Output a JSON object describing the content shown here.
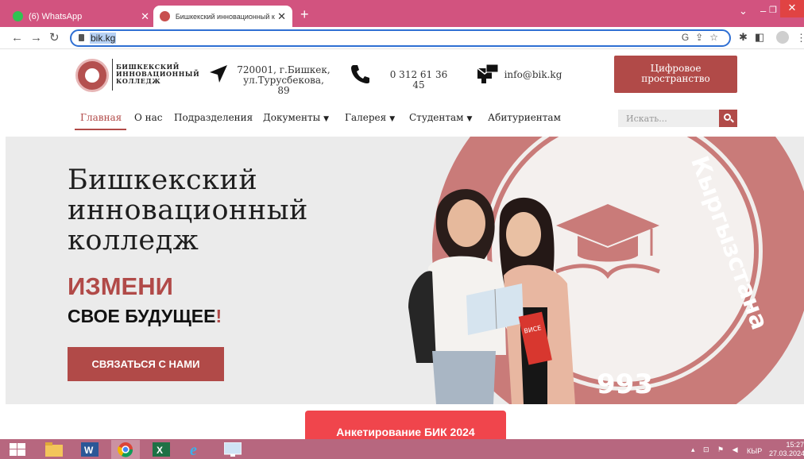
{
  "browser": {
    "tabs": [
      {
        "title": "(6) WhatsApp",
        "icon": "whatsapp-icon"
      },
      {
        "title": "Бишкекский инновационный к",
        "icon": "college-favicon"
      }
    ],
    "url": "bik.kg"
  },
  "logo": {
    "line1": "БИШКЕКСКИЙ",
    "line2": "ИННОВАЦИОННЫЙ",
    "line3": "КОЛЛЕДЖ"
  },
  "contact": {
    "address_line1": "720001, г.Бишкек,",
    "address_line2": "ул.Турусбекова, 89",
    "phone": "0 312 61 36 45",
    "email": "info@bik.kg"
  },
  "digital_button": {
    "line1": "Цифровое",
    "line2": "пространство"
  },
  "nav": {
    "items": [
      "Главная",
      "О нас",
      "Подразделения",
      "Документы",
      "Галерея",
      "Студентам",
      "Абитуриентам"
    ],
    "active": "Главная"
  },
  "search": {
    "placeholder": "Искать..."
  },
  "hero": {
    "title_line1": "Бишкекский",
    "title_line2": "инновационный",
    "title_line3": "колледж",
    "change": "ИЗМЕНИ",
    "future": "СВОЕ БУДУЩЕЕ",
    "excl": "!",
    "contact_button": "СВЯЗАТЬСЯ С НАМИ",
    "seal_text": "Кыргызстана",
    "seal_year": "993",
    "book_label": "ВИСЕ"
  },
  "survey_button": "Анкетирование БИК 2024",
  "taskbar": {
    "lang": "КЫР",
    "time": "15:27",
    "date": "27.03.2024"
  },
  "colors": {
    "brand": "#b14a48",
    "tabbar": "#d2537f",
    "survey": "#f0454c"
  }
}
